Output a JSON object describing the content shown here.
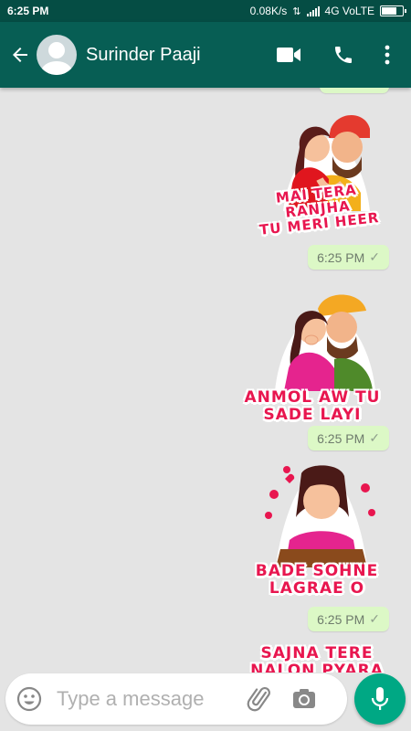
{
  "status_bar": {
    "time": "6:25 PM",
    "speed": "0.08K/s",
    "network": "4G VoLTE",
    "battery_level": 0.8
  },
  "header": {
    "contact_name": "Surinder Paaji"
  },
  "messages": [
    {
      "sticker_text_line1": "MAI TERA RANJHA",
      "sticker_text_line2": "TU MERI HEER",
      "time": "6:25 PM"
    },
    {
      "sticker_text_line1": "ANMOL AW TU",
      "sticker_text_line2": "SADE LAYI",
      "time": "6:25 PM"
    },
    {
      "sticker_text_line1": "BADE SOHNE",
      "sticker_text_line2": "LAGRAE O",
      "time": "6:25 PM"
    },
    {
      "sticker_text_line1": "SAJNA TERE",
      "sticker_text_line2": "NALON PYARA"
    }
  ],
  "composer": {
    "placeholder": "Type a message"
  },
  "colors": {
    "header": "#075e54",
    "status_bar": "#054d44",
    "bubble": "#dcf8c6",
    "accent": "#00a884"
  }
}
